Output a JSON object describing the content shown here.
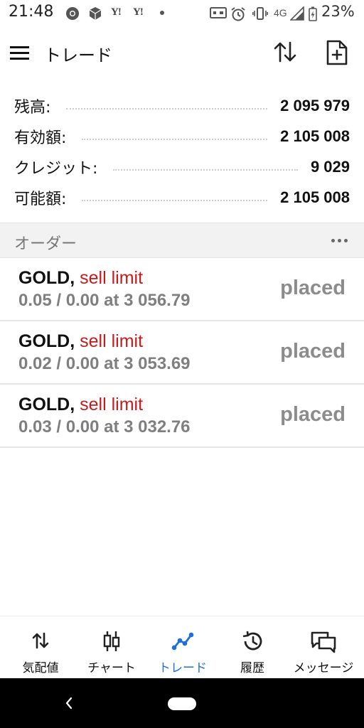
{
  "status_bar": {
    "time": "21:48",
    "network": "4G",
    "battery_percent": "23%",
    "yahoo_1": "Y!",
    "yahoo_2": "Y!"
  },
  "app_bar": {
    "title": "トレード"
  },
  "summary": [
    {
      "label": "残高:",
      "value": "2 095 979"
    },
    {
      "label": "有効額:",
      "value": "2 105 008"
    },
    {
      "label": "クレジット:",
      "value": "9 029"
    },
    {
      "label": "可能額:",
      "value": "2 105 008"
    }
  ],
  "orders": {
    "title": "オーダー",
    "items": [
      {
        "symbol": "GOLD,",
        "type": "sell limit",
        "detail": "0.05 / 0.00 at 3 056.79",
        "status": "placed"
      },
      {
        "symbol": "GOLD,",
        "type": "sell limit",
        "detail": "0.02 / 0.00 at 3 053.69",
        "status": "placed"
      },
      {
        "symbol": "GOLD,",
        "type": "sell limit",
        "detail": "0.03 / 0.00 at 3 032.76",
        "status": "placed"
      }
    ]
  },
  "bottom_nav": [
    {
      "label": "気配値",
      "icon": "quotes-arrows-icon",
      "active": false
    },
    {
      "label": "チャート",
      "icon": "candlestick-chart-icon",
      "active": false
    },
    {
      "label": "トレード",
      "icon": "trade-line-icon",
      "active": true
    },
    {
      "label": "履歴",
      "icon": "history-clock-icon",
      "active": false
    },
    {
      "label": "メッセージ",
      "icon": "messages-chat-icon",
      "active": false
    }
  ],
  "colors": {
    "accent_blue": "#1e6fd9",
    "sell_red": "#c61b1b",
    "muted_gray": "#7f7f7f",
    "section_bg": "#f2f2f2"
  }
}
